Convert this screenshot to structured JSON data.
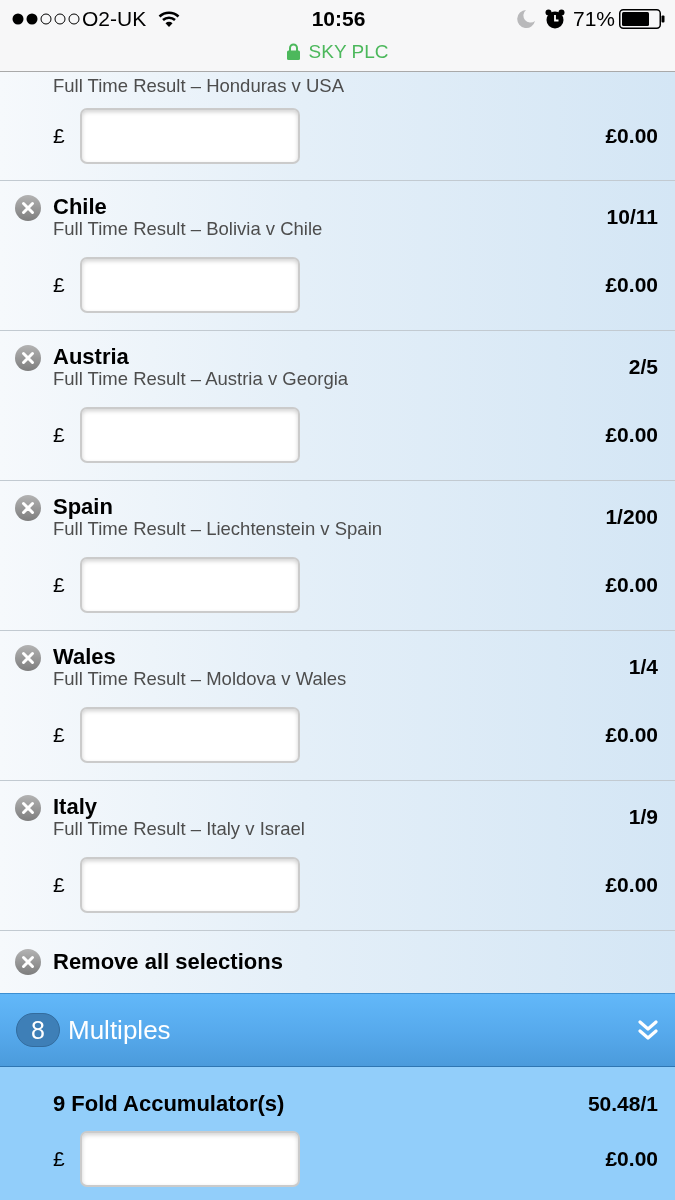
{
  "status_bar": {
    "carrier": "O2-UK",
    "time": "10:56",
    "battery": "71%"
  },
  "address_bar": {
    "site": "SKY PLC"
  },
  "selections": [
    {
      "market": "Full Time Result – Honduras v USA",
      "currency": "£",
      "returns": "£0.00"
    },
    {
      "name": "Chile",
      "market": "Full Time Result – Bolivia v Chile",
      "odds": "10/11",
      "currency": "£",
      "returns": "£0.00"
    },
    {
      "name": "Austria",
      "market": "Full Time Result – Austria v Georgia",
      "odds": "2/5",
      "currency": "£",
      "returns": "£0.00"
    },
    {
      "name": "Spain",
      "market": "Full Time Result – Liechtenstein v Spain",
      "odds": "1/200",
      "currency": "£",
      "returns": "£0.00"
    },
    {
      "name": "Wales",
      "market": "Full Time Result – Moldova v Wales",
      "odds": "1/4",
      "currency": "£",
      "returns": "£0.00"
    },
    {
      "name": "Italy",
      "market": "Full Time Result – Italy v Israel",
      "odds": "1/9",
      "currency": "£",
      "returns": "£0.00"
    }
  ],
  "remove_all": {
    "label": "Remove all selections"
  },
  "multiples": {
    "count": "8",
    "title": "Multiples",
    "bets": [
      {
        "name": "9 Fold Accumulator(s)",
        "odds": "50.48/1",
        "currency": "£",
        "returns": "£0.00"
      }
    ]
  }
}
